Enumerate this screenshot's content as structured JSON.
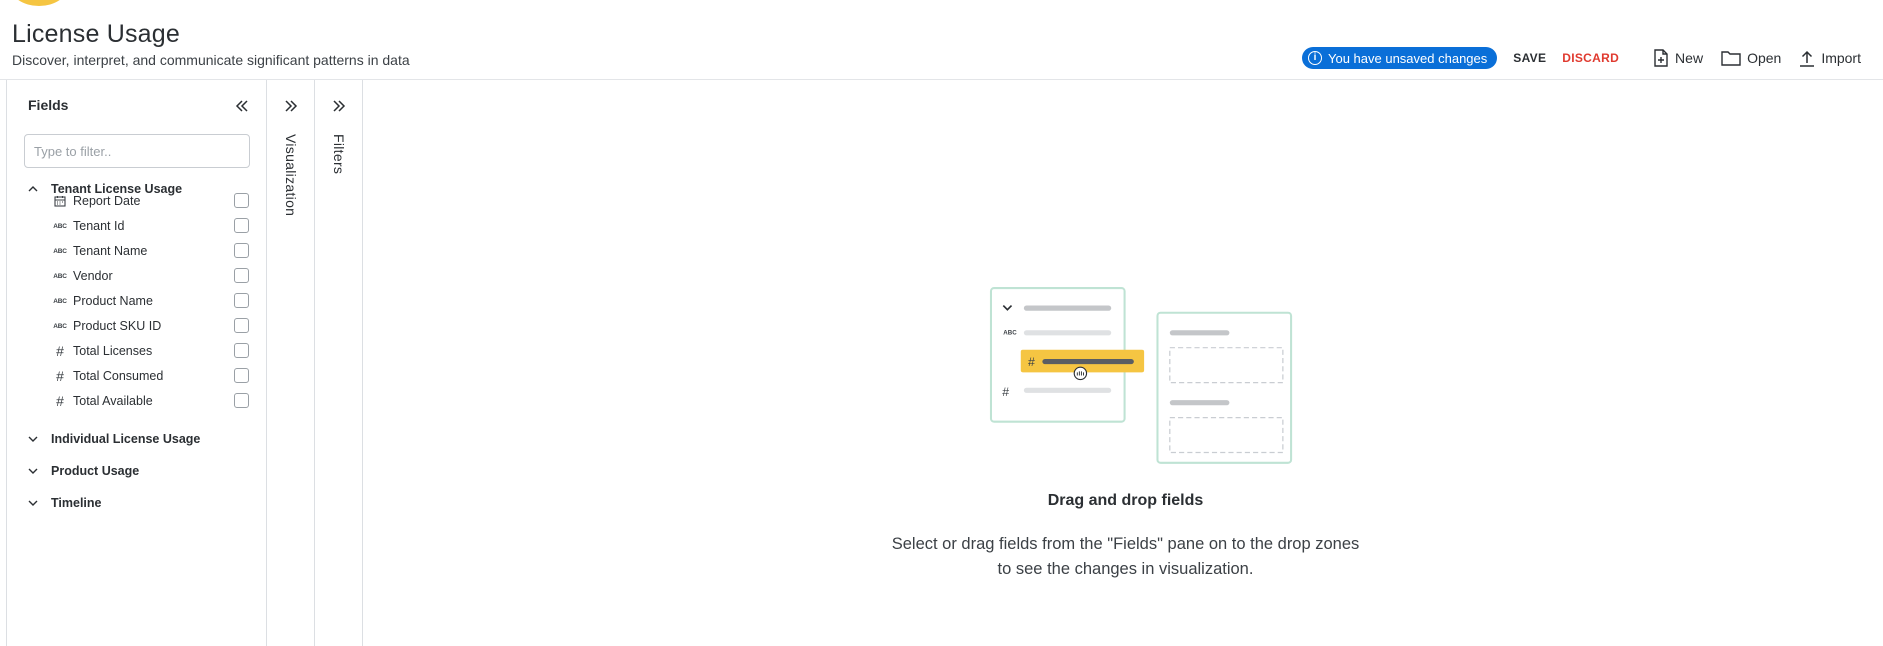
{
  "header": {
    "title": "License Usage",
    "subtitle": "Discover, interpret, and communicate significant patterns in data"
  },
  "toolbar": {
    "unsaved_text": "You have unsaved changes",
    "save_label": "SAVE",
    "discard_label": "DISCARD",
    "new_label": "New",
    "open_label": "Open",
    "import_label": "Import",
    "accent_color": "#0a6fd8",
    "discard_color": "#e03a2f"
  },
  "fields_pane": {
    "title": "Fields",
    "filter_placeholder": "Type to filter..",
    "filter_value": "",
    "groups": [
      {
        "label": "Tenant License Usage",
        "expanded": true,
        "fields": [
          {
            "label": "Report Date",
            "type_icon": "calendar-icon",
            "checked": false
          },
          {
            "label": "Tenant Id",
            "type_icon": "text-type-icon",
            "checked": false
          },
          {
            "label": "Tenant Name",
            "type_icon": "text-type-icon",
            "checked": false
          },
          {
            "label": "Vendor",
            "type_icon": "text-type-icon",
            "checked": false
          },
          {
            "label": "Product Name",
            "type_icon": "text-type-icon",
            "checked": false
          },
          {
            "label": "Product SKU ID",
            "type_icon": "text-type-icon",
            "checked": false
          },
          {
            "label": "Total Licenses",
            "type_icon": "number-type-icon",
            "checked": false
          },
          {
            "label": "Total Consumed",
            "type_icon": "number-type-icon",
            "checked": false
          },
          {
            "label": "Total Available",
            "type_icon": "number-type-icon",
            "checked": false
          }
        ]
      },
      {
        "label": "Individual License Usage",
        "expanded": false
      },
      {
        "label": "Product Usage",
        "expanded": false
      },
      {
        "label": "Timeline",
        "expanded": false
      }
    ]
  },
  "side_tabs": {
    "visualization_label": "Visualization",
    "filters_label": "Filters"
  },
  "empty_state": {
    "title": "Drag and drop fields",
    "line1": "Select or drag fields from the \"Fields\" pane on to the drop zones",
    "line2": "to see the changes in visualization."
  }
}
